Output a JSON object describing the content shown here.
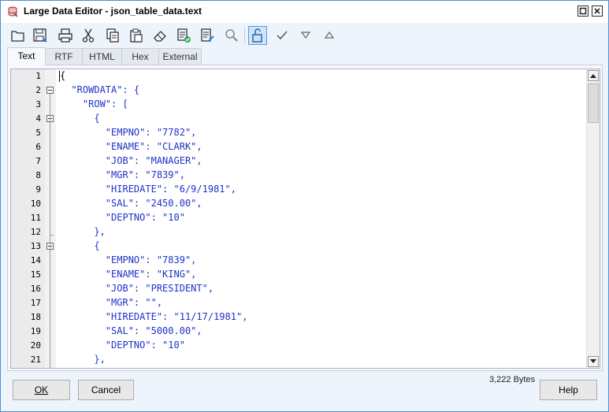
{
  "window": {
    "title": "Large Data Editor - json_table_data.text",
    "accent": "#4a8fd9"
  },
  "toolbar": {
    "buttons": [
      {
        "name": "open-folder-icon"
      },
      {
        "name": "save-icon"
      },
      {
        "name": "print-icon"
      },
      {
        "name": "cut-icon"
      },
      {
        "name": "copy-icon"
      },
      {
        "name": "paste-icon"
      },
      {
        "name": "eraser-icon"
      },
      {
        "name": "validate-document-icon"
      },
      {
        "name": "edit-document-icon"
      },
      {
        "name": "search-icon"
      },
      {
        "name": "unlock-icon",
        "active": true
      },
      {
        "name": "checkmark-icon"
      },
      {
        "name": "arrow-down-icon"
      },
      {
        "name": "arrow-up-icon"
      }
    ]
  },
  "tabs": [
    "Text",
    "RTF",
    "HTML",
    "Hex",
    "External"
  ],
  "selected_tab": "Text",
  "editor": {
    "lines": [
      {
        "n": "1",
        "text": "{"
      },
      {
        "n": "2",
        "text": "  \"ROWDATA\": {"
      },
      {
        "n": "3",
        "text": "    \"ROW\": ["
      },
      {
        "n": "4",
        "text": "      {"
      },
      {
        "n": "5",
        "text": "        \"EMPNO\": \"7782\","
      },
      {
        "n": "6",
        "text": "        \"ENAME\": \"CLARK\","
      },
      {
        "n": "7",
        "text": "        \"JOB\": \"MANAGER\","
      },
      {
        "n": "8",
        "text": "        \"MGR\": \"7839\","
      },
      {
        "n": "9",
        "text": "        \"HIREDATE\": \"6/9/1981\","
      },
      {
        "n": "10",
        "text": "        \"SAL\": \"2450.00\","
      },
      {
        "n": "11",
        "text": "        \"DEPTNO\": \"10\""
      },
      {
        "n": "12",
        "text": "      },"
      },
      {
        "n": "13",
        "text": "      {"
      },
      {
        "n": "14",
        "text": "        \"EMPNO\": \"7839\","
      },
      {
        "n": "15",
        "text": "        \"ENAME\": \"KING\","
      },
      {
        "n": "16",
        "text": "        \"JOB\": \"PRESIDENT\","
      },
      {
        "n": "17",
        "text": "        \"MGR\": \"\","
      },
      {
        "n": "18",
        "text": "        \"HIREDATE\": \"11/17/1981\","
      },
      {
        "n": "19",
        "text": "        \"SAL\": \"5000.00\","
      },
      {
        "n": "20",
        "text": "        \"DEPTNO\": \"10\""
      },
      {
        "n": "21",
        "text": "      },"
      }
    ],
    "text_color": "#1e32c8"
  },
  "footer": {
    "size": "3,222 Bytes",
    "ok_label": "OK",
    "cancel_label": "Cancel",
    "help_label": "Help"
  }
}
